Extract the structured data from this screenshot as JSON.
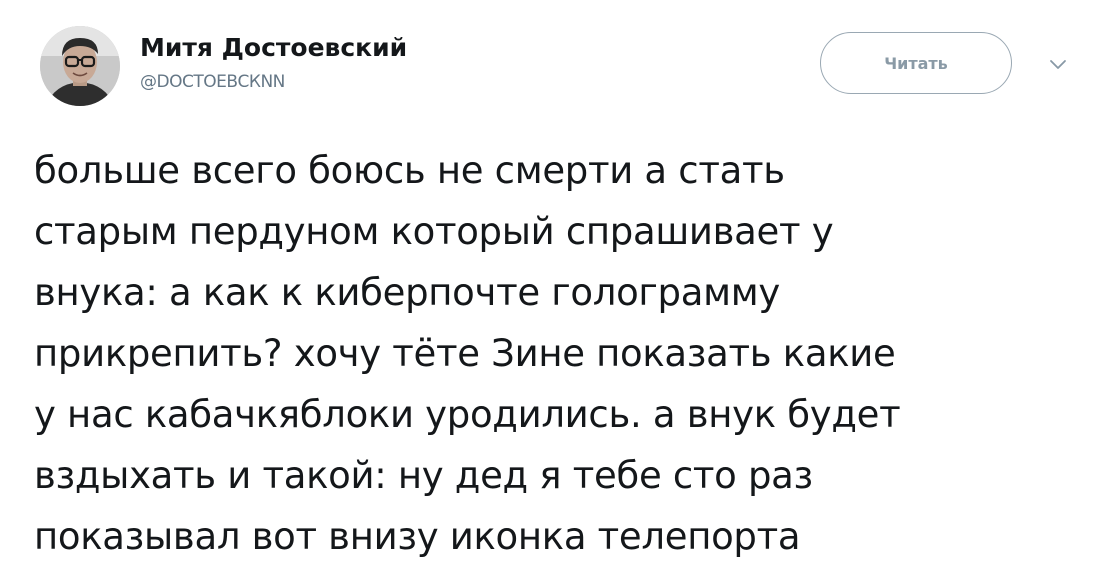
{
  "user": {
    "display_name": "Митя Достоевский",
    "handle": "@DOСТОЕВСКNN"
  },
  "follow_button": {
    "label": "Читать"
  },
  "icons": {
    "avatar": "avatar-photo",
    "caret": "chevron-down-icon"
  },
  "colors": {
    "text": "#14171a",
    "secondary": "#657786",
    "button_border": "#9aa8b3"
  },
  "tweet": {
    "lines": [
      "больше всего боюсь не смерти а стать",
      "старым пердуном который спрашивает у",
      "внука: а как к киберпочте голограмму",
      "прикрепить? хочу тёте Зине показать какие",
      "у нас кабачкяблоки уродились. а внук будет",
      "вздыхать и такой: ну дед я тебе сто раз",
      "показывал вот внизу иконка телепорта"
    ]
  }
}
